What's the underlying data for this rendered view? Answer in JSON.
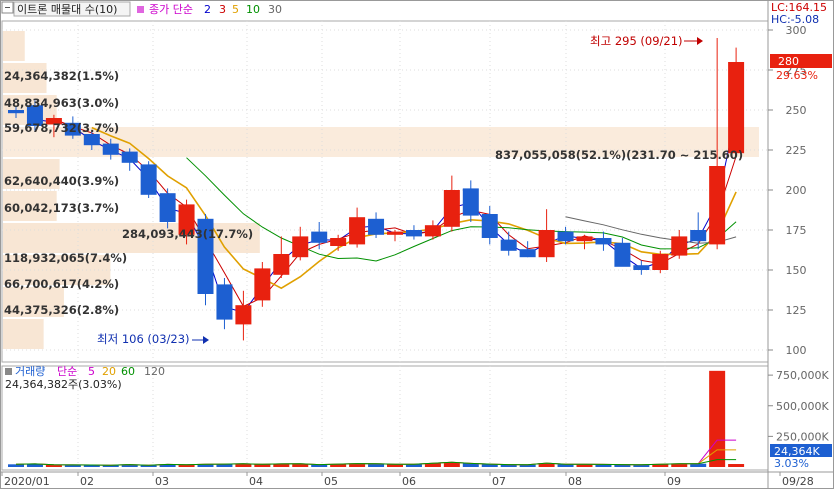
{
  "title_box": {
    "title": "이트론 매물대 수(10)",
    "ma_label": "종가 단순",
    "ma_periods": [
      "2",
      "3",
      "5",
      "10",
      "30"
    ],
    "ma_colors": [
      "#0000cc",
      "#cc0000",
      "#e0a000",
      "#009000",
      "#666666"
    ]
  },
  "top_right": {
    "lc": "LC:164.15",
    "hc": "HC:-5.08"
  },
  "price_axis": {
    "ticks": [
      "300",
      "275",
      "250",
      "225",
      "200",
      "175",
      "150",
      "125",
      "100"
    ],
    "current_price": "280",
    "current_change": "29.63%"
  },
  "volume_legend": {
    "label": "거래량",
    "ma_label": "단순",
    "periods": [
      "5",
      "20",
      "60",
      "120"
    ],
    "colors": [
      "#cc00cc",
      "#e0a000",
      "#009000",
      "#666666"
    ],
    "current_volume": "24,364,382주(3.03%)"
  },
  "volume_axis": {
    "ticks": [
      "750,000K",
      "500,000K",
      "250,000K"
    ],
    "current_volume": "24,364K",
    "current_pct": "3.03%"
  },
  "date_axis": [
    "2020/01",
    "02",
    "03",
    "04",
    "05",
    "06",
    "07",
    "08",
    "09",
    "09/28"
  ],
  "annotations": {
    "high": "최고 295 (09/21)",
    "low": "최저 106 (03/23)"
  },
  "volume_profile": [
    {
      "label": "24,364,382(1.5%)"
    },
    {
      "label": "48,834,963(3.0%)"
    },
    {
      "label": "59,678,732(3.7%)"
    },
    {
      "label": "837,055,058(52.1%)(231.70 ~ 215.60)"
    },
    {
      "label": "62,640,440(3.9%)"
    },
    {
      "label": "60,042,173(3.7%)"
    },
    {
      "label": "284,093,443(17.7%)"
    },
    {
      "label": "118,932,065(7.4%)"
    },
    {
      "label": "66,700,617(4.2%)"
    },
    {
      "label": "44,375,326(2.8%)"
    }
  ],
  "chart_data": {
    "type": "candlestick",
    "period": "weekly",
    "price_ylim": [
      100,
      300
    ],
    "volume_ylim": [
      0,
      800000
    ],
    "volume_unit": "K",
    "volume_profile_pct": [
      1.5,
      3.0,
      3.7,
      52.1,
      3.9,
      3.7,
      17.7,
      7.4,
      4.2,
      2.8
    ],
    "volume_profile_volumes": [
      24364382,
      48834963,
      59678732,
      837055058,
      62640440,
      60042173,
      284093443,
      118932065,
      66700617,
      44375326
    ],
    "candles": [
      {
        "o": 250,
        "h": 252,
        "l": 245,
        "c": 248
      },
      {
        "o": 253,
        "h": 256,
        "l": 237,
        "c": 240
      },
      {
        "o": 241,
        "h": 247,
        "l": 233,
        "c": 245
      },
      {
        "o": 242,
        "h": 246,
        "l": 232,
        "c": 234
      },
      {
        "o": 235,
        "h": 237,
        "l": 225,
        "c": 228
      },
      {
        "o": 229,
        "h": 232,
        "l": 219,
        "c": 222
      },
      {
        "o": 224,
        "h": 226,
        "l": 212,
        "c": 217
      },
      {
        "o": 216,
        "h": 218,
        "l": 195,
        "c": 197
      },
      {
        "o": 198,
        "h": 201,
        "l": 176,
        "c": 180
      },
      {
        "o": 172,
        "h": 194,
        "l": 166,
        "c": 191
      },
      {
        "o": 182,
        "h": 185,
        "l": 128,
        "c": 135
      },
      {
        "o": 141,
        "h": 145,
        "l": 113,
        "c": 119
      },
      {
        "o": 116,
        "h": 137,
        "l": 106,
        "c": 128
      },
      {
        "o": 131,
        "h": 155,
        "l": 127,
        "c": 151
      },
      {
        "o": 147,
        "h": 171,
        "l": 145,
        "c": 160
      },
      {
        "o": 158,
        "h": 177,
        "l": 156,
        "c": 171
      },
      {
        "o": 174,
        "h": 180,
        "l": 163,
        "c": 167
      },
      {
        "o": 165,
        "h": 172,
        "l": 162,
        "c": 170
      },
      {
        "o": 166,
        "h": 189,
        "l": 164,
        "c": 183
      },
      {
        "o": 182,
        "h": 186,
        "l": 170,
        "c": 172
      },
      {
        "o": 172,
        "h": 175,
        "l": 168,
        "c": 174
      },
      {
        "o": 175,
        "h": 178,
        "l": 169,
        "c": 171
      },
      {
        "o": 171,
        "h": 181,
        "l": 169,
        "c": 178
      },
      {
        "o": 177,
        "h": 209,
        "l": 174,
        "c": 200
      },
      {
        "o": 201,
        "h": 206,
        "l": 180,
        "c": 184
      },
      {
        "o": 185,
        "h": 190,
        "l": 166,
        "c": 170
      },
      {
        "o": 169,
        "h": 174,
        "l": 159,
        "c": 162
      },
      {
        "o": 163,
        "h": 168,
        "l": 158,
        "c": 158
      },
      {
        "o": 158,
        "h": 188,
        "l": 155,
        "c": 175
      },
      {
        "o": 174,
        "h": 177,
        "l": 166,
        "c": 168
      },
      {
        "o": 168,
        "h": 172,
        "l": 163,
        "c": 171
      },
      {
        "o": 170,
        "h": 174,
        "l": 162,
        "c": 166
      },
      {
        "o": 167,
        "h": 170,
        "l": 155,
        "c": 152
      },
      {
        "o": 153,
        "h": 156,
        "l": 147,
        "c": 150
      },
      {
        "o": 150,
        "h": 162,
        "l": 148,
        "c": 160
      },
      {
        "o": 159,
        "h": 175,
        "l": 157,
        "c": 171
      },
      {
        "o": 175,
        "h": 186,
        "l": 163,
        "c": 168
      },
      {
        "o": 166,
        "h": 295,
        "l": 163,
        "c": 215
      },
      {
        "o": 223,
        "h": 289,
        "l": 222,
        "c": 280
      }
    ],
    "volumes": [
      22000,
      25000,
      18000,
      17000,
      16000,
      14000,
      20000,
      15000,
      21000,
      19000,
      23000,
      24000,
      26000,
      22000,
      25000,
      27000,
      20000,
      24000,
      28000,
      26000,
      23000,
      22000,
      30000,
      38000,
      29000,
      24000,
      20000,
      19000,
      32000,
      23000,
      22000,
      21000,
      20000,
      18000,
      22000,
      26000,
      27000,
      785000,
      24364
    ]
  }
}
